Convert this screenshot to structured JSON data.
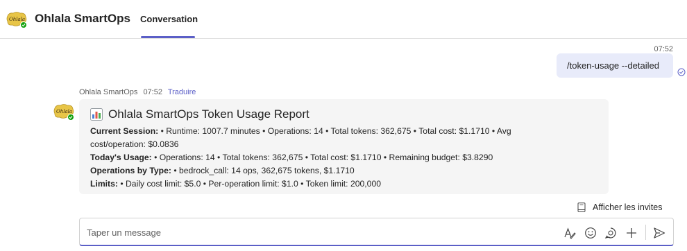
{
  "header": {
    "app_title": "Ohlala SmartOps",
    "tab_label": "Conversation",
    "logo_text": "Ohlala"
  },
  "sent_message": {
    "time": "07:52",
    "text": "/token-usage --detailed"
  },
  "bot_message": {
    "sender": "Ohlala SmartOps",
    "time": "07:52",
    "translate_label": "Traduire",
    "title_icon": "bar-chart-emoji",
    "title": "Ohlala SmartOps Token Usage Report",
    "lines": [
      {
        "label": "Current Session:",
        "text": " • Runtime: 1007.7 minutes • Operations: 14 • Total tokens: 362,675 • Total cost: $1.1710 • Avg"
      },
      {
        "label": "",
        "text": "cost/operation: $0.0836"
      },
      {
        "label": "Today's Usage:",
        "text": " • Operations: 14 • Total tokens: 362,675 • Total cost: $1.1710 • Remaining budget: $3.8290"
      },
      {
        "label": "Operations by Type:",
        "text": " • bedrock_call: 14 ops, 362,675 tokens, $1.1710"
      },
      {
        "label": "Limits:",
        "text": " • Daily cost limit: $5.0 • Per-operation limit: $1.0 • Token limit: 200,000"
      }
    ]
  },
  "invites_label": "Afficher les invites",
  "compose": {
    "placeholder": "Taper un message"
  },
  "colors": {
    "accent": "#5b5fc7",
    "sent_bubble": "#e8ebfa",
    "card_bg": "#f5f5f5",
    "status_green": "#13a10e",
    "logo_yellow": "#e8c547"
  }
}
